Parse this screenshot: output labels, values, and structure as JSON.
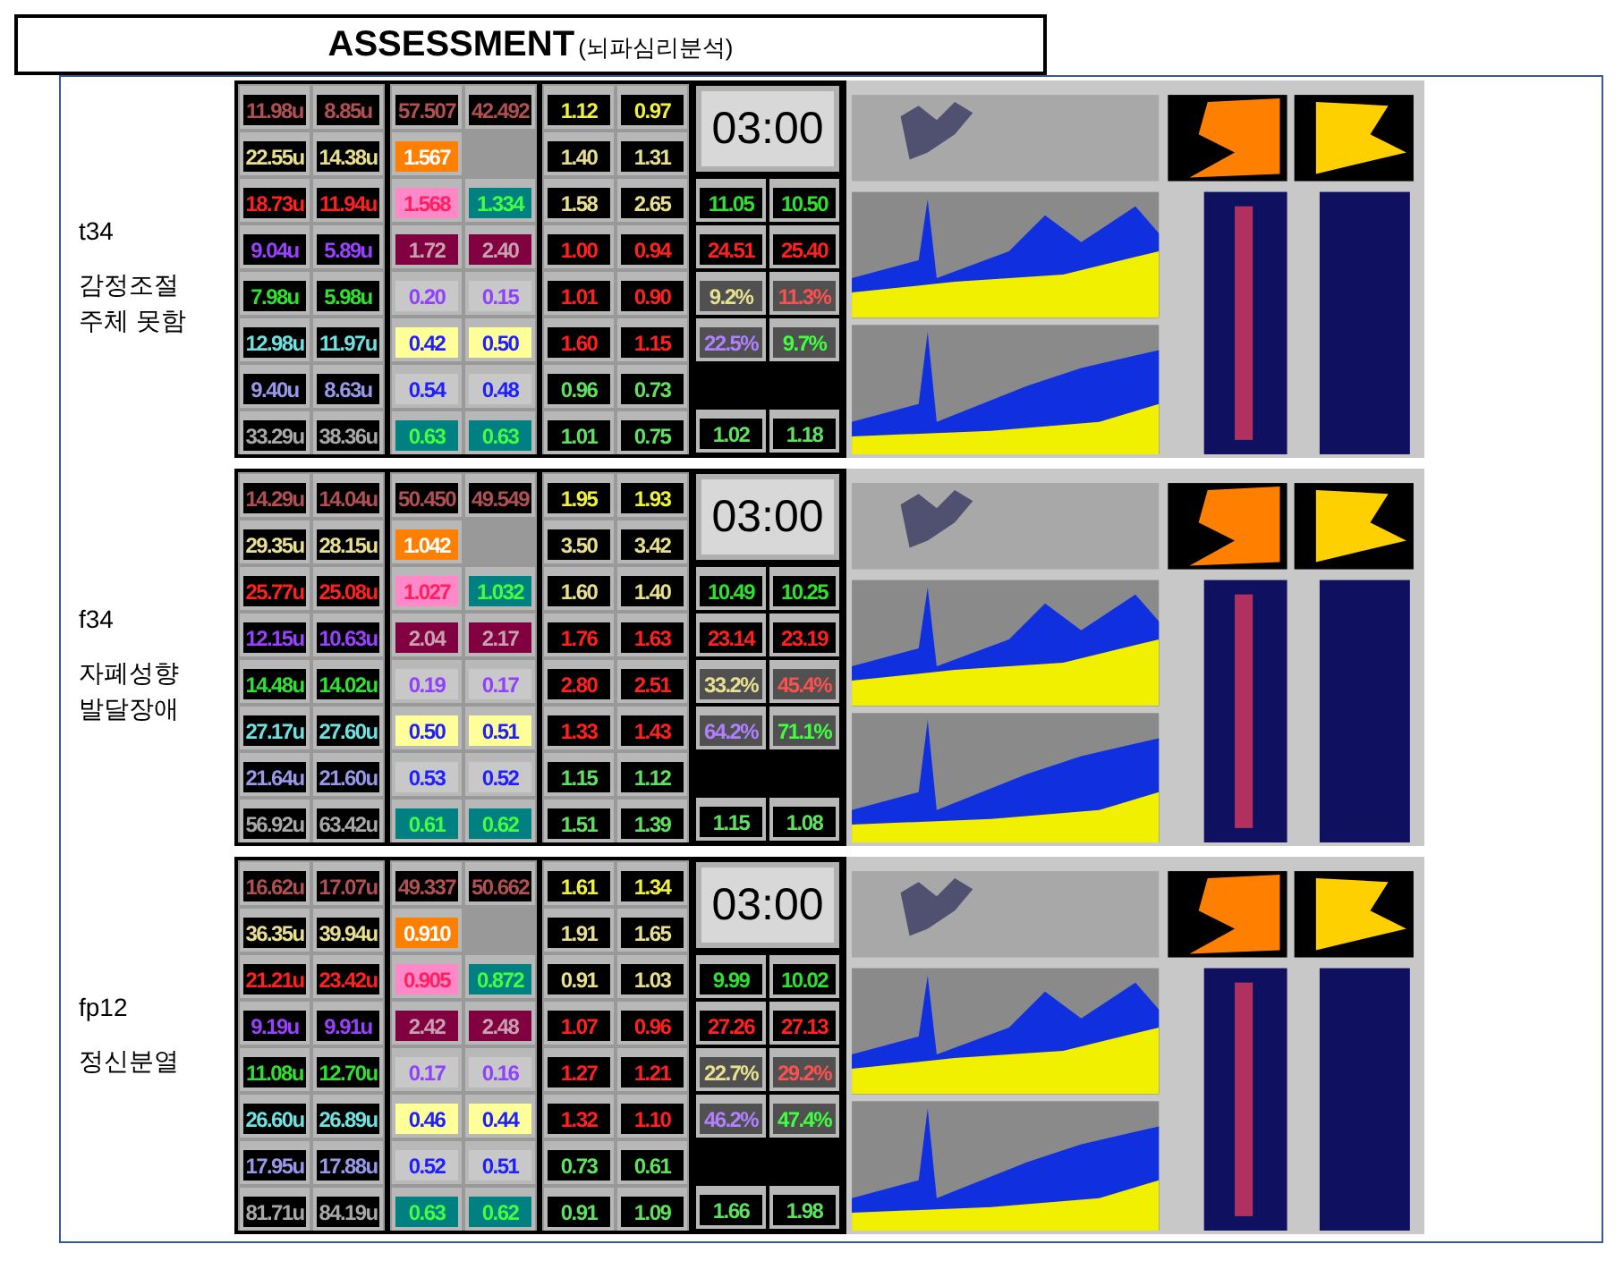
{
  "title": "ASSESSMENT",
  "subtitle": "(뇌파심리분석)",
  "cases": [
    {
      "code": "t34",
      "description": [
        "감정조절",
        "주체 못함"
      ],
      "timer": "03:00",
      "group_1": [
        {
          "kind": "dark",
          "values": [
            "11.98u",
            "8.85u"
          ]
        },
        {
          "kind": "dark",
          "values": [
            "22.55u",
            "14.38u"
          ]
        },
        {
          "kind": "dark",
          "values": [
            "18.73u",
            "11.94u"
          ]
        },
        {
          "kind": "dark",
          "values": [
            "9.04u",
            "5.89u"
          ]
        },
        {
          "kind": "dark",
          "values": [
            "7.98u",
            "5.98u"
          ]
        },
        {
          "kind": "dark",
          "values": [
            "12.98u",
            "11.97u"
          ]
        },
        {
          "kind": "dark",
          "values": [
            "9.40u",
            "8.63u"
          ]
        },
        {
          "kind": "dark",
          "values": [
            "33.29u",
            "38.36u"
          ]
        }
      ],
      "group_2": [
        {
          "kind": "dark",
          "values": [
            "57.507",
            "42.492"
          ]
        },
        {
          "kind": "orange",
          "values": [
            "1.567"
          ]
        },
        {
          "cells": [
            {
              "kind": "pink",
              "value": "1.568"
            },
            {
              "kind": "teal",
              "value": "1.334"
            }
          ]
        },
        {
          "kind": "maroon",
          "values": [
            "1.72",
            "2.40"
          ]
        },
        {
          "kind": "gray",
          "values": [
            "0.20",
            "0.15"
          ]
        },
        {
          "kind": "yellow",
          "values": [
            "0.42",
            "0.50"
          ]
        },
        {
          "kind": "gray",
          "values": [
            "0.54",
            "0.48"
          ]
        },
        {
          "kind": "teal",
          "values": [
            "0.63",
            "0.63"
          ]
        }
      ],
      "group_3": [
        {
          "kind": "dark",
          "values": [
            "1.12",
            "0.97"
          ]
        },
        {
          "kind": "dark",
          "values": [
            "1.40",
            "1.31"
          ]
        },
        {
          "kind": "dark",
          "values": [
            "1.58",
            "2.65"
          ]
        },
        {
          "kind": "dark",
          "values": [
            "1.00",
            "0.94"
          ]
        },
        {
          "kind": "dark",
          "values": [
            "1.01",
            "0.90"
          ]
        },
        {
          "kind": "dark",
          "values": [
            "1.60",
            "1.15"
          ]
        },
        {
          "kind": "dark",
          "values": [
            "0.96",
            "0.73"
          ]
        },
        {
          "kind": "dark",
          "values": [
            "1.01",
            "0.75"
          ]
        }
      ],
      "group_4": [
        {
          "kind": "dark",
          "values": [
            "11.05",
            "10.50"
          ]
        },
        {
          "kind": "dark",
          "values": [
            "24.51",
            "25.40"
          ]
        },
        {
          "kind": "slate",
          "values": [
            "9.2%",
            "11.3%"
          ]
        },
        {
          "kind": "slate",
          "values": [
            "22.5%",
            "9.7%"
          ]
        }
      ],
      "bottom_row": {
        "kind": "dark",
        "values": [
          "1.02",
          "1.18"
        ]
      }
    },
    {
      "code": "f34",
      "description": [
        "자폐성향",
        "발달장애"
      ],
      "timer": "03:00",
      "group_1": [
        {
          "kind": "dark",
          "values": [
            "14.29u",
            "14.04u"
          ]
        },
        {
          "kind": "dark",
          "values": [
            "29.35u",
            "28.15u"
          ]
        },
        {
          "kind": "dark",
          "values": [
            "25.77u",
            "25.08u"
          ]
        },
        {
          "kind": "dark",
          "values": [
            "12.15u",
            "10.63u"
          ]
        },
        {
          "kind": "dark",
          "values": [
            "14.48u",
            "14.02u"
          ]
        },
        {
          "kind": "dark",
          "values": [
            "27.17u",
            "27.60u"
          ]
        },
        {
          "kind": "dark",
          "values": [
            "21.64u",
            "21.60u"
          ]
        },
        {
          "kind": "dark",
          "values": [
            "56.92u",
            "63.42u"
          ]
        }
      ],
      "group_2": [
        {
          "kind": "dark",
          "values": [
            "50.450",
            "49.549"
          ]
        },
        {
          "kind": "orange",
          "values": [
            "1.042"
          ]
        },
        {
          "cells": [
            {
              "kind": "pink",
              "value": "1.027"
            },
            {
              "kind": "teal",
              "value": "1.032"
            }
          ]
        },
        {
          "kind": "maroon",
          "values": [
            "2.04",
            "2.17"
          ]
        },
        {
          "kind": "gray",
          "values": [
            "0.19",
            "0.17"
          ]
        },
        {
          "kind": "yellow",
          "values": [
            "0.50",
            "0.51"
          ]
        },
        {
          "kind": "gray",
          "values": [
            "0.53",
            "0.52"
          ]
        },
        {
          "kind": "teal",
          "values": [
            "0.61",
            "0.62"
          ]
        }
      ],
      "group_3": [
        {
          "kind": "dark",
          "values": [
            "1.95",
            "1.93"
          ]
        },
        {
          "kind": "dark",
          "values": [
            "3.50",
            "3.42"
          ]
        },
        {
          "kind": "dark",
          "values": [
            "1.60",
            "1.40"
          ]
        },
        {
          "kind": "dark",
          "values": [
            "1.76",
            "1.63"
          ]
        },
        {
          "kind": "dark",
          "values": [
            "2.80",
            "2.51"
          ]
        },
        {
          "kind": "dark",
          "values": [
            "1.33",
            "1.43"
          ]
        },
        {
          "kind": "dark",
          "values": [
            "1.15",
            "1.12"
          ]
        },
        {
          "kind": "dark",
          "values": [
            "1.51",
            "1.39"
          ]
        }
      ],
      "group_4": [
        {
          "kind": "dark",
          "values": [
            "10.49",
            "10.25"
          ]
        },
        {
          "kind": "dark",
          "values": [
            "23.14",
            "23.19"
          ]
        },
        {
          "kind": "slate",
          "values": [
            "33.2%",
            "45.4%"
          ]
        },
        {
          "kind": "slate",
          "values": [
            "64.2%",
            "71.1%"
          ]
        }
      ],
      "bottom_row": {
        "kind": "dark",
        "values": [
          "1.15",
          "1.08"
        ]
      }
    },
    {
      "code": "fp12",
      "description": [
        "정신분열"
      ],
      "timer": "03:00",
      "group_1": [
        {
          "kind": "dark",
          "values": [
            "16.62u",
            "17.07u"
          ]
        },
        {
          "kind": "dark",
          "values": [
            "36.35u",
            "39.94u"
          ]
        },
        {
          "kind": "dark",
          "values": [
            "21.21u",
            "23.42u"
          ]
        },
        {
          "kind": "dark",
          "values": [
            "9.19u",
            "9.91u"
          ]
        },
        {
          "kind": "dark",
          "values": [
            "11.08u",
            "12.70u"
          ]
        },
        {
          "kind": "dark",
          "values": [
            "26.60u",
            "26.89u"
          ]
        },
        {
          "kind": "dark",
          "values": [
            "17.95u",
            "17.88u"
          ]
        },
        {
          "kind": "dark",
          "values": [
            "81.71u",
            "84.19u"
          ]
        }
      ],
      "group_2": [
        {
          "kind": "dark",
          "values": [
            "49.337",
            "50.662"
          ]
        },
        {
          "kind": "orange",
          "values": [
            "0.910"
          ]
        },
        {
          "cells": [
            {
              "kind": "pink",
              "value": "0.905"
            },
            {
              "kind": "teal",
              "value": "0.872"
            }
          ]
        },
        {
          "kind": "maroon",
          "values": [
            "2.42",
            "2.48"
          ]
        },
        {
          "kind": "gray",
          "values": [
            "0.17",
            "0.16"
          ]
        },
        {
          "kind": "yellow",
          "values": [
            "0.46",
            "0.44"
          ]
        },
        {
          "kind": "gray",
          "values": [
            "0.52",
            "0.51"
          ]
        },
        {
          "kind": "teal",
          "values": [
            "0.63",
            "0.62"
          ]
        }
      ],
      "group_3": [
        {
          "kind": "dark",
          "values": [
            "1.61",
            "1.34"
          ]
        },
        {
          "kind": "dark",
          "values": [
            "1.91",
            "1.65"
          ]
        },
        {
          "kind": "dark",
          "values": [
            "0.91",
            "1.03"
          ]
        },
        {
          "kind": "dark",
          "values": [
            "1.07",
            "0.96"
          ]
        },
        {
          "kind": "dark",
          "values": [
            "1.27",
            "1.21"
          ]
        },
        {
          "kind": "dark",
          "values": [
            "1.32",
            "1.10"
          ]
        },
        {
          "kind": "dark",
          "values": [
            "0.73",
            "0.61"
          ]
        },
        {
          "kind": "dark",
          "values": [
            "0.91",
            "1.09"
          ]
        }
      ],
      "group_4": [
        {
          "kind": "dark",
          "values": [
            "9.99",
            "10.02"
          ]
        },
        {
          "kind": "dark",
          "values": [
            "27.26",
            "27.13"
          ]
        },
        {
          "kind": "slate",
          "values": [
            "22.7%",
            "29.2%"
          ]
        },
        {
          "kind": "slate",
          "values": [
            "46.2%",
            "47.4%"
          ]
        }
      ],
      "bottom_row": {
        "kind": "dark",
        "values": [
          "1.66",
          "1.98"
        ]
      }
    }
  ]
}
